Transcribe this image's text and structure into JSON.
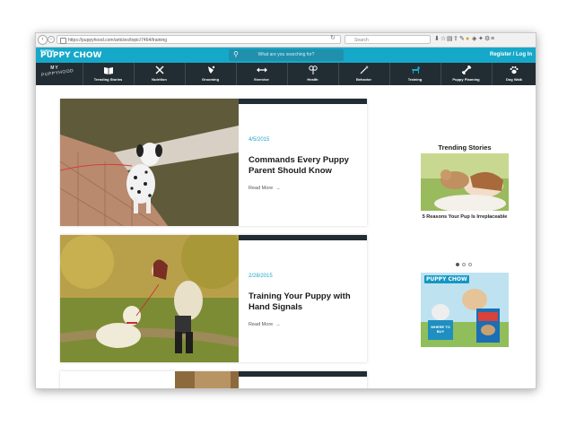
{
  "browser": {
    "url": "https://puppyhood.com/articles/topic/7464/training",
    "search_placeholder": "Search"
  },
  "header": {
    "logo_top": "PURINA",
    "logo": "PUPPY CHOW",
    "search_placeholder": "What are you searching for?",
    "register_login": "Register / Log In"
  },
  "nav": {
    "brand_line1": "MY",
    "brand_line2": "PUPPYHOOD",
    "items": [
      {
        "label": "Trending Stories",
        "icon": "book-icon"
      },
      {
        "label": "Nutrition",
        "icon": "fork-knife-icon"
      },
      {
        "label": "Grooming",
        "icon": "grooming-icon"
      },
      {
        "label": "Exercise",
        "icon": "arrows-icon"
      },
      {
        "label": "Health",
        "icon": "health-icon"
      },
      {
        "label": "Behavior",
        "icon": "wand-icon"
      },
      {
        "label": "Training",
        "icon": "dog-icon"
      },
      {
        "label": "Puppy Planning",
        "icon": "bone-icon"
      },
      {
        "label": "Dog Walk",
        "icon": "paw-icon"
      }
    ],
    "active_color": "#16a8c9"
  },
  "articles": [
    {
      "date": "4/5/2015",
      "title": "Commands Every Puppy Parent Should Know",
      "read_more": "Read More"
    },
    {
      "date": "2/28/2015",
      "title": "Training Your Puppy with Hand Signals",
      "read_more": "Read More"
    },
    {
      "date": "",
      "title": "",
      "read_more": ""
    }
  ],
  "sidebar": {
    "title": "Trending Stories",
    "story_caption": "5 Reasons Your Pup Is Irreplaceable",
    "carousel_dots": 3,
    "carousel_active": 1,
    "ad_logo": "PUPPY CHOW",
    "ad_text": "WHERE TO BUY"
  },
  "colors": {
    "brand": "#16a8c9",
    "dark": "#222d33",
    "accent_date": "#1fa7c7"
  }
}
